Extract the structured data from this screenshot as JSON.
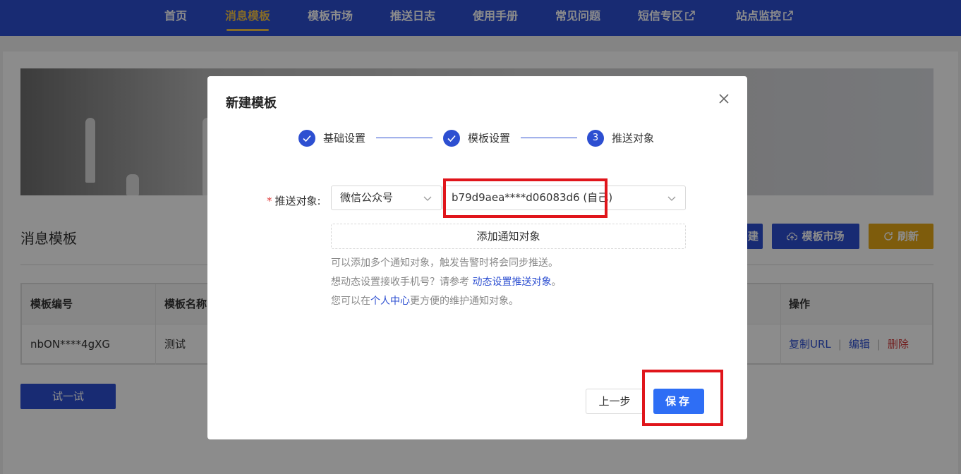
{
  "nav": {
    "items": [
      {
        "label": "首页"
      },
      {
        "label": "消息模板"
      },
      {
        "label": "模板市场"
      },
      {
        "label": "推送日志"
      },
      {
        "label": "使用手册"
      },
      {
        "label": "常见问题"
      },
      {
        "label": "短信专区"
      },
      {
        "label": "站点监控"
      }
    ],
    "active_index": 1
  },
  "page": {
    "title": "消息模板",
    "toolbar": {
      "create_label": "建",
      "market_label": "模板市场",
      "refresh_label": "刷新"
    },
    "table": {
      "headers": [
        "模板编号",
        "模板名称",
        "操作"
      ],
      "rows": [
        {
          "id": "nbON****4gXG",
          "name": "测试",
          "actions": [
            "复制URL",
            "编辑",
            "删除"
          ]
        }
      ]
    },
    "try_label": "试一试"
  },
  "modal": {
    "title": "新建模板",
    "steps": [
      {
        "label": "基础设置",
        "status": "done"
      },
      {
        "label": "模板设置",
        "status": "done"
      },
      {
        "label": "推送对象",
        "status": "current",
        "number": "3"
      }
    ],
    "field_label": "推送对象:",
    "channel_select": "微信公众号",
    "target_select": "b79d9aea****d06083d6 (自己)",
    "add_target_label": "添加通知对象",
    "hint1": "可以添加多个通知对象，触发告警时将会同步推送。",
    "hint2_prefix": "想动态设置接收手机号？请参考",
    "hint2_link": "动态设置推送对象",
    "hint2_suffix": "。",
    "hint3_prefix": "您可以在",
    "hint3_link": "个人中心",
    "hint3_suffix": "更方便的维护通知对象。",
    "prev_label": "上一步",
    "save_label": "保存"
  },
  "colors": {
    "primary": "#2d4fd1",
    "nav_active": "#f2c44a",
    "refresh": "#e6a817",
    "save": "#2e6ef5",
    "highlight": "#e0151b",
    "danger": "#d0393a"
  }
}
